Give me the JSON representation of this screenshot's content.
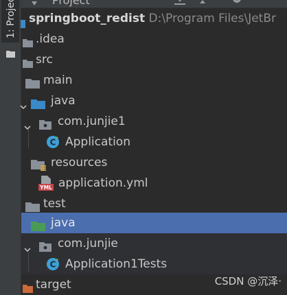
{
  "sidebar": {
    "project_tab_label": "1: Project"
  },
  "header": {
    "title": "Project"
  },
  "tree": {
    "root": {
      "name": "springboot_redist",
      "path": "D:\\Program Files\\JetBr"
    },
    "items": [
      {
        "label": ".idea"
      },
      {
        "label": "src"
      },
      {
        "label": "main"
      },
      {
        "label": "java"
      },
      {
        "label": "com.junjie1"
      },
      {
        "label": "Application"
      },
      {
        "label": "resources"
      },
      {
        "label": "application.yml"
      },
      {
        "label": "test"
      },
      {
        "label": "java"
      },
      {
        "label": "com.junjie"
      },
      {
        "label": "Application1Tests"
      },
      {
        "label": "target"
      }
    ]
  },
  "watermark": "CSDN @沉泽·",
  "colors": {
    "background": "#2b2b2b",
    "selection": "#4b6eaf",
    "folder": "#8a9099",
    "source_folder": "#3a89c9",
    "test_folder": "#499c54",
    "excluded_folder": "#cc6a3a",
    "class_icon": "#3ea0d8"
  }
}
